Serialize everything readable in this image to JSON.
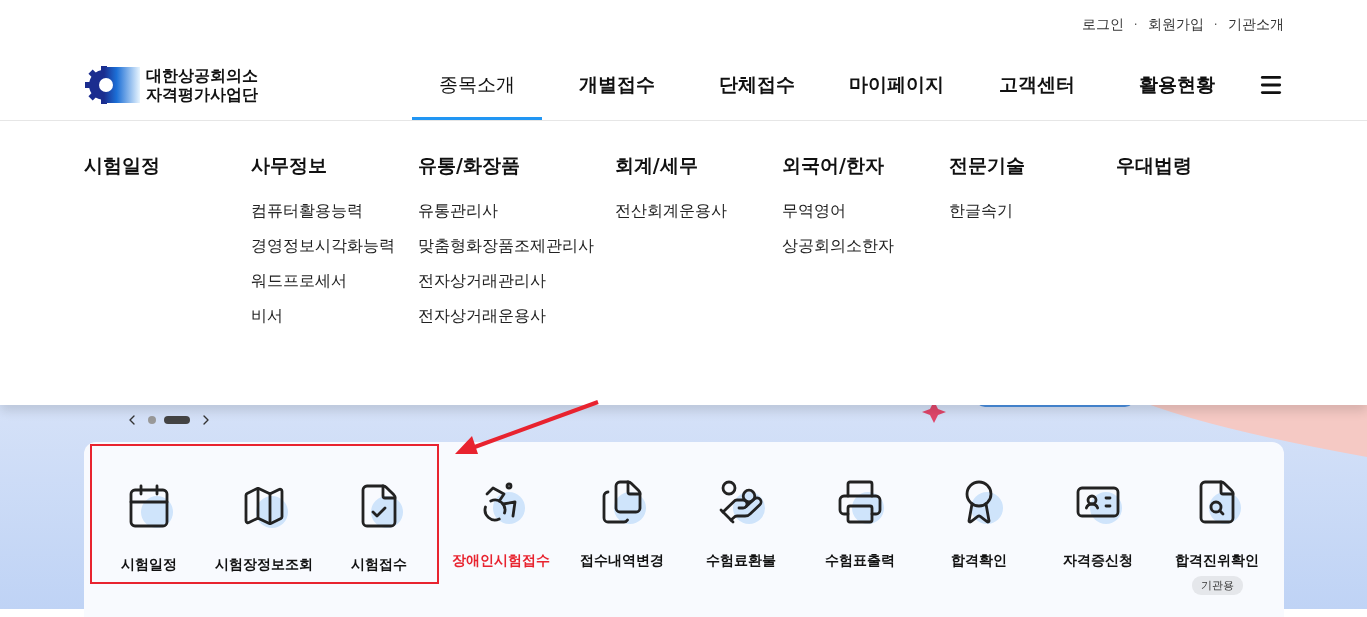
{
  "top_links": [
    "로그인",
    "회원가입",
    "기관소개"
  ],
  "top_link_separator": "·",
  "logo": {
    "line_1": "대한상공회의소",
    "line_2": "자격평가사업단"
  },
  "nav": [
    {
      "label": "종목소개",
      "selected": true
    },
    {
      "label": "개별접수",
      "selected": false
    },
    {
      "label": "단체접수",
      "selected": false
    },
    {
      "label": "마이페이지",
      "selected": false
    },
    {
      "label": "고객센터",
      "selected": false
    },
    {
      "label": "활용현황",
      "selected": false
    }
  ],
  "mega_menu": [
    {
      "title": "시험일정"
    },
    {
      "title": "사무정보",
      "items": [
        "컴퓨터활용능력",
        "경영정보시각화능력",
        "워드프로세서",
        "비서"
      ]
    },
    {
      "title": "유통/화장품",
      "items": [
        "유통관리사",
        "맞춤형화장품조제관리사",
        "전자상거래관리사",
        "전자상거래운용사"
      ]
    },
    {
      "title": "회계/세무",
      "items": [
        "전산회계운용사"
      ]
    },
    {
      "title": "외국어/한자",
      "items": [
        "무역영어",
        "상공회의소한자"
      ]
    },
    {
      "title": "전문기술",
      "items": [
        "한글속기"
      ]
    },
    {
      "title": "우대법령"
    }
  ],
  "carousel": {
    "slides": [
      {
        "selected": false
      },
      {
        "selected": true
      }
    ]
  },
  "quick_menu": {
    "highlighted": [
      {
        "label": "시험일정",
        "kind": "calendar",
        "emphasis": false
      },
      {
        "label": "시험장정보조회",
        "kind": "map",
        "emphasis": false
      },
      {
        "label": "시험접수",
        "kind": "form",
        "emphasis": false
      }
    ],
    "items": [
      {
        "label": "장애인시험접수",
        "kind": "wheelchair",
        "emphasis": true
      },
      {
        "label": "접수내역변경",
        "kind": "files",
        "emphasis": false
      },
      {
        "label": "수험료환불",
        "kind": "refund",
        "emphasis": false
      },
      {
        "label": "수험표출력",
        "kind": "printer",
        "emphasis": false
      },
      {
        "label": "합격확인",
        "kind": "certificate",
        "emphasis": false
      },
      {
        "label": "자격증신청",
        "kind": "idcard",
        "emphasis": false
      },
      {
        "label": "합격진위확인",
        "kind": "verify",
        "emphasis": false,
        "badge": "기관용"
      }
    ]
  }
}
